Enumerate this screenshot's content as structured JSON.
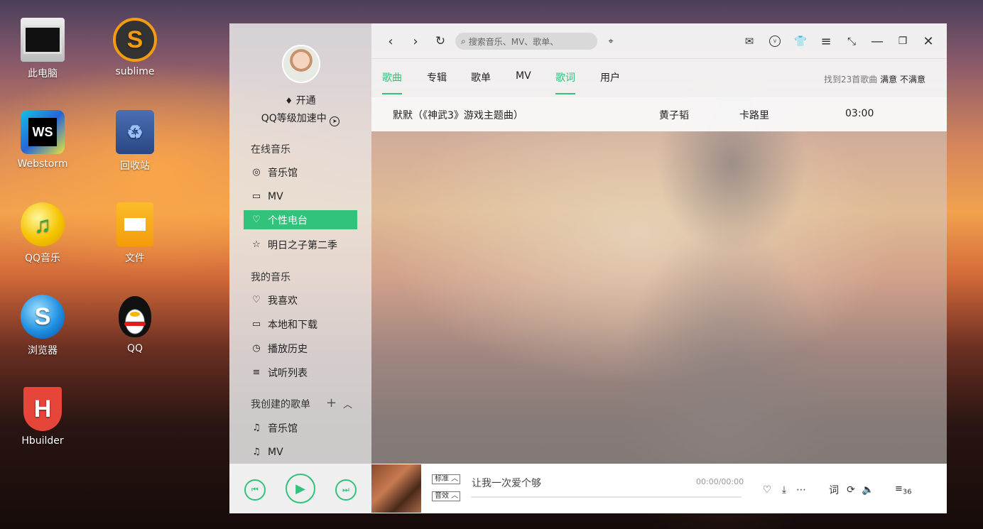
{
  "desktop": {
    "icons": [
      {
        "label": "此电脑",
        "icon": "computer-icon"
      },
      {
        "label": "sublime",
        "icon": "sublime-icon"
      },
      {
        "label": "Webstorm",
        "icon": "webstorm-icon"
      },
      {
        "label": "回收站",
        "icon": "recycle-bin-icon"
      },
      {
        "label": "QQ音乐",
        "icon": "qq-music-icon"
      },
      {
        "label": "文件",
        "icon": "notebook-icon"
      },
      {
        "label": "浏览器",
        "icon": "browser-icon"
      },
      {
        "label": "QQ",
        "icon": "qq-penguin-icon"
      },
      {
        "label": "Hbuilder",
        "icon": "hbuilder-icon"
      }
    ],
    "icon_glyphs": {
      "sublime": "S",
      "webstorm": "WS",
      "hbuilder": "H",
      "browser": "S"
    }
  },
  "sidebar": {
    "vip_label": "开通",
    "speed_label": "QQ等级加速中",
    "online_music_title": "在线音乐",
    "online_items": [
      {
        "label": "音乐馆",
        "icon": "disc-icon"
      },
      {
        "label": "MV",
        "icon": "video-icon"
      },
      {
        "label": "个性电台",
        "icon": "radio-heart-icon",
        "active": true
      },
      {
        "label": "明日之子第二季",
        "icon": "star-icon"
      }
    ],
    "my_music_title": "我的音乐",
    "my_items": [
      {
        "label": "我喜欢",
        "icon": "heart-icon"
      },
      {
        "label": "本地和下载",
        "icon": "monitor-icon"
      },
      {
        "label": "播放历史",
        "icon": "clock-icon"
      },
      {
        "label": "试听列表",
        "icon": "playlist-icon"
      }
    ],
    "created_title": "我创建的歌单",
    "created_items": [
      {
        "label": "音乐馆",
        "icon": "music-note-icon"
      },
      {
        "label": "MV",
        "icon": "music-note-icon"
      }
    ]
  },
  "topbar": {
    "search_placeholder": "搜索音乐、MV、歌单、"
  },
  "tabs": [
    {
      "label": "歌曲",
      "active": true
    },
    {
      "label": "专辑",
      "active": false
    },
    {
      "label": "歌单",
      "active": false
    },
    {
      "label": "MV",
      "active": false
    },
    {
      "label": "歌词",
      "active": true
    },
    {
      "label": "用户",
      "active": false
    }
  ],
  "result_info": {
    "found": "找到23首歌曲",
    "satisfied": "满意",
    "unsatisfied": "不满意"
  },
  "results": [
    {
      "title": "默默（《神武3》游戏主题曲）",
      "artist": "黄子韬",
      "album": "卡路里",
      "duration": "03:00"
    }
  ],
  "player": {
    "quality_label": "标准",
    "effect_label": "音效",
    "now_playing": "让我一次爱个够",
    "time": "00:00/00:00",
    "progress": 0,
    "lyrics_label": "词",
    "playlist_count": "36"
  },
  "colors": {
    "accent": "#31c27c"
  }
}
